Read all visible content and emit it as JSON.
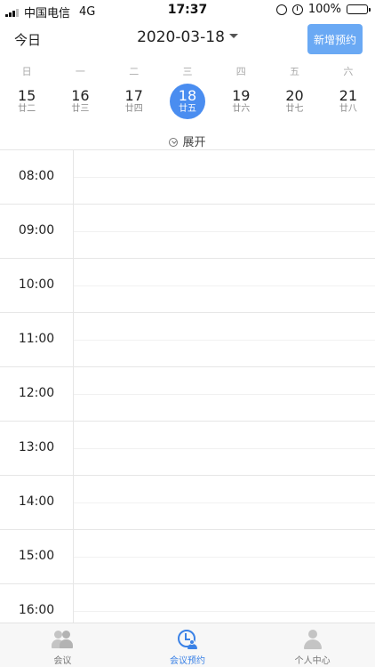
{
  "status_bar": {
    "carrier": "中国电信",
    "network": "4G",
    "time": "17:37",
    "battery": "100%"
  },
  "header": {
    "today_label": "今日",
    "current_date": "2020-03-18",
    "new_booking_label": "新增预约"
  },
  "week": {
    "labels": [
      "日",
      "一",
      "二",
      "三",
      "四",
      "五",
      "六"
    ],
    "days": [
      {
        "num": "15",
        "lunar": "廿二"
      },
      {
        "num": "16",
        "lunar": "廿三"
      },
      {
        "num": "17",
        "lunar": "廿四"
      },
      {
        "num": "18",
        "lunar": "廿五"
      },
      {
        "num": "19",
        "lunar": "廿六"
      },
      {
        "num": "20",
        "lunar": "廿七"
      },
      {
        "num": "21",
        "lunar": "廿八"
      }
    ],
    "selected_index": 3
  },
  "expand_label": "展开",
  "timeline": {
    "hours": [
      "08:00",
      "09:00",
      "10:00",
      "11:00",
      "12:00",
      "13:00",
      "14:00",
      "15:00",
      "16:00"
    ]
  },
  "tabs": [
    {
      "label": "会议",
      "icon": "meeting-icon"
    },
    {
      "label": "会议预约",
      "icon": "booking-clock-icon"
    },
    {
      "label": "个人中心",
      "icon": "profile-icon"
    }
  ],
  "colors": {
    "accent": "#4a8df0",
    "new_button": "#6aa9f4",
    "active_tab": "#3b82e6"
  }
}
